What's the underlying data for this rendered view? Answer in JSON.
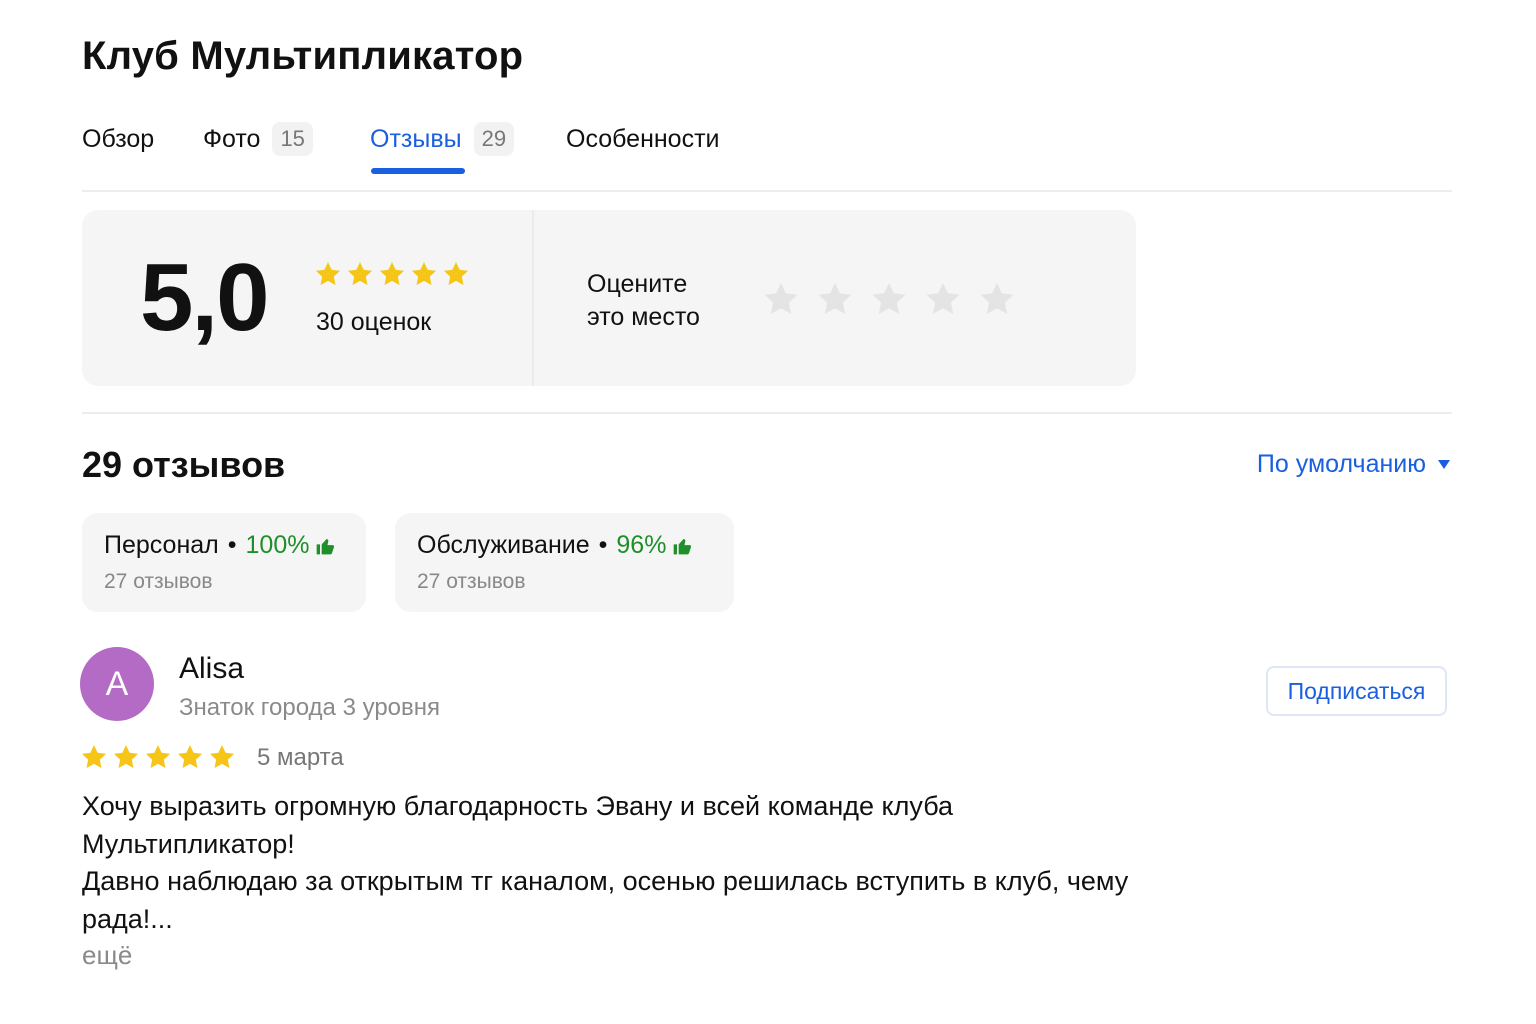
{
  "header": {
    "title": "Клуб Мультипликатор"
  },
  "tabs": [
    {
      "label": "Обзор",
      "count": ""
    },
    {
      "label": "Фото",
      "count": "15"
    },
    {
      "label": "Отзывы",
      "count": "29"
    },
    {
      "label": "Особенности",
      "count": ""
    }
  ],
  "active_tab": "Отзывы",
  "rating": {
    "score": "5,0",
    "stars": 5,
    "count_label": "30 оценок",
    "rate_label_line1": "Оцените",
    "rate_label_line2": "это место",
    "rate_stars": 5
  },
  "reviews": {
    "heading": "29 отзывов",
    "sort_label": "По умолчанию",
    "aspects": [
      {
        "name": "Персонал",
        "percent": "100%",
        "count": "27 отзывов"
      },
      {
        "name": "Обслуживание",
        "percent": "96%",
        "count": "27 отзывов"
      }
    ]
  },
  "review": {
    "avatar_letter": "A",
    "author": "Alisa",
    "level": "Знаток города 3 уровня",
    "subscribe_label": "Подписаться",
    "stars": 5,
    "date": "5 марта",
    "text_line1": "Хочу выразить огромную благодарность Эвану и всей команде клуба",
    "text_line2": "Мультипликатор!",
    "text_line3": "Давно наблюдаю за открытым тг каналом, осенью решилась вступить в клуб, чему",
    "text_line4": "рада!...",
    "more_label": "ещё"
  },
  "colors": {
    "accent": "#1a5fe0",
    "star_filled": "#f5c518",
    "star_empty": "#e4e4e4",
    "positive": "#1f8f2a",
    "avatar_bg": "#b46bc5"
  },
  "icons": {
    "star": "star-icon",
    "thumb": "thumbs-up-icon",
    "caret": "caret-down-icon"
  }
}
